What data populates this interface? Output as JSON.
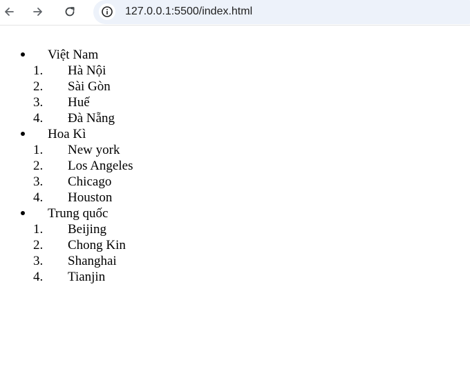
{
  "browser": {
    "url": "127.0.0.1:5500/index.html"
  },
  "list": [
    {
      "country": "Việt Nam",
      "cities": [
        {
          "num": "1.",
          "name": "Hà Nội"
        },
        {
          "num": "2.",
          "name": "Sài Gòn"
        },
        {
          "num": "3.",
          "name": "Huế"
        },
        {
          "num": "4.",
          "name": "Đà Nẵng"
        }
      ]
    },
    {
      "country": "Hoa Kì",
      "cities": [
        {
          "num": "1.",
          "name": "New york"
        },
        {
          "num": "2.",
          "name": "Los Angeles"
        },
        {
          "num": "3.",
          "name": "Chicago"
        },
        {
          "num": "4.",
          "name": "Houston"
        }
      ]
    },
    {
      "country": "Trung quốc",
      "cities": [
        {
          "num": "1.",
          "name": "Beijing"
        },
        {
          "num": "2.",
          "name": "Chong Kin"
        },
        {
          "num": "3.",
          "name": "Shanghai"
        },
        {
          "num": "4.",
          "name": "Tianjin"
        }
      ]
    }
  ]
}
